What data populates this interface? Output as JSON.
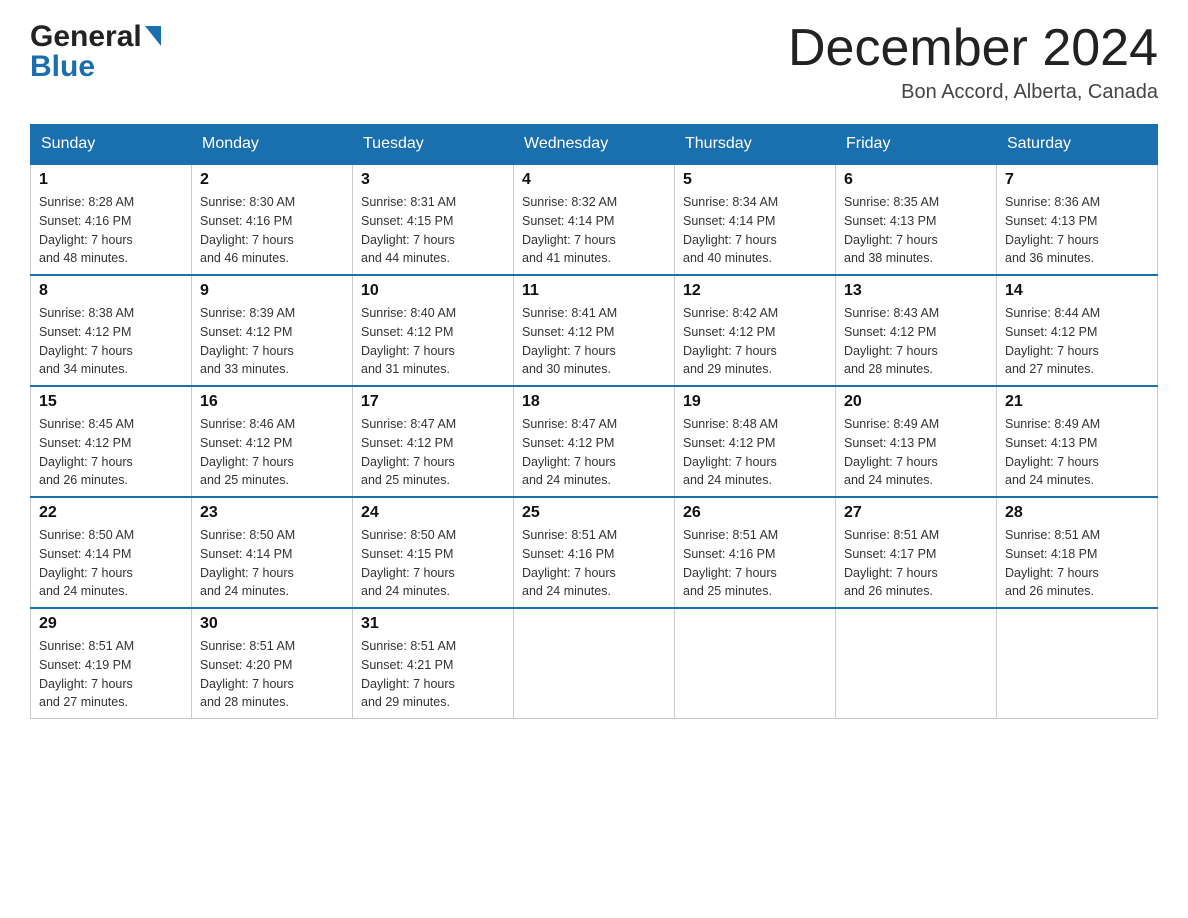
{
  "header": {
    "logo_general": "General",
    "logo_blue": "Blue",
    "month_title": "December 2024",
    "location": "Bon Accord, Alberta, Canada"
  },
  "days_of_week": [
    "Sunday",
    "Monday",
    "Tuesday",
    "Wednesday",
    "Thursday",
    "Friday",
    "Saturday"
  ],
  "weeks": [
    [
      {
        "day": "1",
        "sunrise": "8:28 AM",
        "sunset": "4:16 PM",
        "daylight": "7 hours and 48 minutes."
      },
      {
        "day": "2",
        "sunrise": "8:30 AM",
        "sunset": "4:16 PM",
        "daylight": "7 hours and 46 minutes."
      },
      {
        "day": "3",
        "sunrise": "8:31 AM",
        "sunset": "4:15 PM",
        "daylight": "7 hours and 44 minutes."
      },
      {
        "day": "4",
        "sunrise": "8:32 AM",
        "sunset": "4:14 PM",
        "daylight": "7 hours and 41 minutes."
      },
      {
        "day": "5",
        "sunrise": "8:34 AM",
        "sunset": "4:14 PM",
        "daylight": "7 hours and 40 minutes."
      },
      {
        "day": "6",
        "sunrise": "8:35 AM",
        "sunset": "4:13 PM",
        "daylight": "7 hours and 38 minutes."
      },
      {
        "day": "7",
        "sunrise": "8:36 AM",
        "sunset": "4:13 PM",
        "daylight": "7 hours and 36 minutes."
      }
    ],
    [
      {
        "day": "8",
        "sunrise": "8:38 AM",
        "sunset": "4:12 PM",
        "daylight": "7 hours and 34 minutes."
      },
      {
        "day": "9",
        "sunrise": "8:39 AM",
        "sunset": "4:12 PM",
        "daylight": "7 hours and 33 minutes."
      },
      {
        "day": "10",
        "sunrise": "8:40 AM",
        "sunset": "4:12 PM",
        "daylight": "7 hours and 31 minutes."
      },
      {
        "day": "11",
        "sunrise": "8:41 AM",
        "sunset": "4:12 PM",
        "daylight": "7 hours and 30 minutes."
      },
      {
        "day": "12",
        "sunrise": "8:42 AM",
        "sunset": "4:12 PM",
        "daylight": "7 hours and 29 minutes."
      },
      {
        "day": "13",
        "sunrise": "8:43 AM",
        "sunset": "4:12 PM",
        "daylight": "7 hours and 28 minutes."
      },
      {
        "day": "14",
        "sunrise": "8:44 AM",
        "sunset": "4:12 PM",
        "daylight": "7 hours and 27 minutes."
      }
    ],
    [
      {
        "day": "15",
        "sunrise": "8:45 AM",
        "sunset": "4:12 PM",
        "daylight": "7 hours and 26 minutes."
      },
      {
        "day": "16",
        "sunrise": "8:46 AM",
        "sunset": "4:12 PM",
        "daylight": "7 hours and 25 minutes."
      },
      {
        "day": "17",
        "sunrise": "8:47 AM",
        "sunset": "4:12 PM",
        "daylight": "7 hours and 25 minutes."
      },
      {
        "day": "18",
        "sunrise": "8:47 AM",
        "sunset": "4:12 PM",
        "daylight": "7 hours and 24 minutes."
      },
      {
        "day": "19",
        "sunrise": "8:48 AM",
        "sunset": "4:12 PM",
        "daylight": "7 hours and 24 minutes."
      },
      {
        "day": "20",
        "sunrise": "8:49 AM",
        "sunset": "4:13 PM",
        "daylight": "7 hours and 24 minutes."
      },
      {
        "day": "21",
        "sunrise": "8:49 AM",
        "sunset": "4:13 PM",
        "daylight": "7 hours and 24 minutes."
      }
    ],
    [
      {
        "day": "22",
        "sunrise": "8:50 AM",
        "sunset": "4:14 PM",
        "daylight": "7 hours and 24 minutes."
      },
      {
        "day": "23",
        "sunrise": "8:50 AM",
        "sunset": "4:14 PM",
        "daylight": "7 hours and 24 minutes."
      },
      {
        "day": "24",
        "sunrise": "8:50 AM",
        "sunset": "4:15 PM",
        "daylight": "7 hours and 24 minutes."
      },
      {
        "day": "25",
        "sunrise": "8:51 AM",
        "sunset": "4:16 PM",
        "daylight": "7 hours and 24 minutes."
      },
      {
        "day": "26",
        "sunrise": "8:51 AM",
        "sunset": "4:16 PM",
        "daylight": "7 hours and 25 minutes."
      },
      {
        "day": "27",
        "sunrise": "8:51 AM",
        "sunset": "4:17 PM",
        "daylight": "7 hours and 26 minutes."
      },
      {
        "day": "28",
        "sunrise": "8:51 AM",
        "sunset": "4:18 PM",
        "daylight": "7 hours and 26 minutes."
      }
    ],
    [
      {
        "day": "29",
        "sunrise": "8:51 AM",
        "sunset": "4:19 PM",
        "daylight": "7 hours and 27 minutes."
      },
      {
        "day": "30",
        "sunrise": "8:51 AM",
        "sunset": "4:20 PM",
        "daylight": "7 hours and 28 minutes."
      },
      {
        "day": "31",
        "sunrise": "8:51 AM",
        "sunset": "4:21 PM",
        "daylight": "7 hours and 29 minutes."
      },
      null,
      null,
      null,
      null
    ]
  ],
  "labels": {
    "sunrise": "Sunrise:",
    "sunset": "Sunset:",
    "daylight": "Daylight:"
  }
}
